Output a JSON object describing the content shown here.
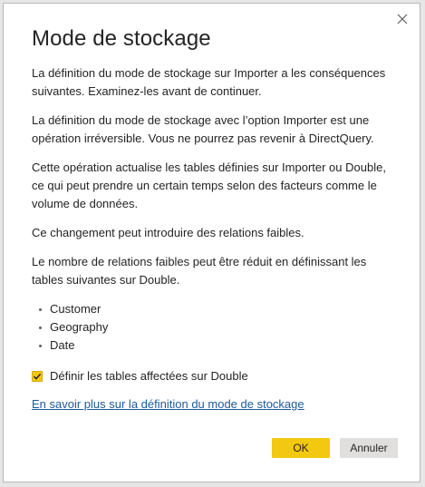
{
  "dialog": {
    "title": "Mode de stockage",
    "paragraphs": [
      "La définition du mode de stockage sur Importer a les conséquences suivantes. Examinez-les avant de continuer.",
      "La définition du mode de stockage avec l’option Importer est une opération irréversible. Vous ne pourrez pas revenir à DirectQuery.",
      "Cette opération actualise les tables définies sur Importer ou Double, ce qui peut prendre un certain temps selon des facteurs comme le volume de données.",
      "Ce changement peut introduire des relations faibles.",
      "Le nombre de relations faibles peut être réduit en définissant les tables suivantes sur Double."
    ],
    "tables": [
      "Customer",
      "Geography",
      "Date"
    ],
    "checkbox": {
      "label": "Définir les tables affectées sur Double",
      "checked": true
    },
    "learn_more_link": "En savoir plus sur la définition du mode de stockage",
    "ok_label": "OK",
    "cancel_label": "Annuler",
    "close_icon": "close-icon"
  },
  "colors": {
    "accent": "#f2c811",
    "link": "#1c5a9e",
    "text": "#252423",
    "secondary_button": "#e1dfdd"
  }
}
